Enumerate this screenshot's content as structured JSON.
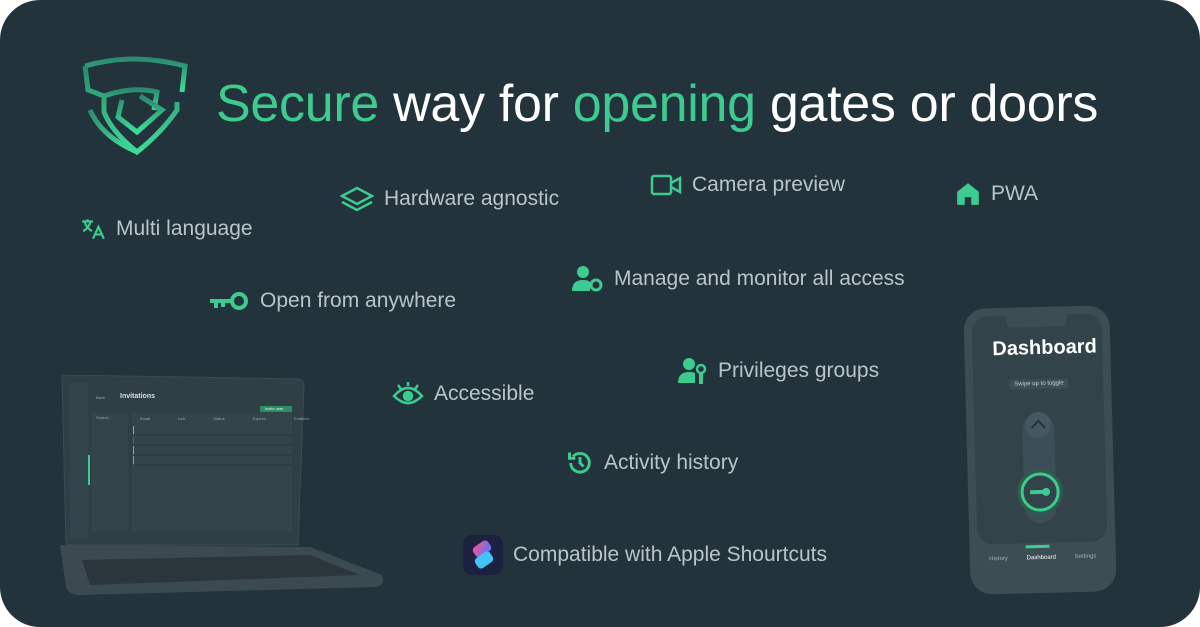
{
  "headline": {
    "w1": "Secure",
    "w2": " way for ",
    "w3": "opening",
    "w4": " gates or doors"
  },
  "features": [
    {
      "label": "Multi language",
      "icon": "translate-icon"
    },
    {
      "label": "Hardware agnostic",
      "icon": "layers-icon"
    },
    {
      "label": "Camera preview",
      "icon": "video-camera-icon"
    },
    {
      "label": "PWA",
      "icon": "home-icon"
    },
    {
      "label": "Manage and monitor all access",
      "icon": "user-gear-icon"
    },
    {
      "label": "Open from anywhere",
      "icon": "key-icon"
    },
    {
      "label": "Privileges groups",
      "icon": "user-lock-icon"
    },
    {
      "label": "Accessible",
      "icon": "eye-icon"
    },
    {
      "label": "Activity history",
      "icon": "history-icon"
    },
    {
      "label": "Compatible with Apple Shourtcuts",
      "icon": "shortcuts-app-icon"
    }
  ],
  "laptop": {
    "page_title": "Invitations",
    "back": "Back",
    "search_placeholder": "Search",
    "invite_button": "Invite user",
    "columns": [
      "Email",
      "Link",
      "Status",
      "Expires",
      "Enabled"
    ],
    "row_colors": [
      "#3ecb8f",
      "#b03a3a",
      "#c9932a",
      "#c9932a"
    ]
  },
  "phone": {
    "title": "Dashboard",
    "hint": "Swipe up to toggle",
    "nav": [
      "History",
      "Dashboard",
      "Settings"
    ],
    "active_nav": "Dashboard"
  },
  "colors": {
    "background": "#22333b",
    "accent": "#3ecb8f",
    "text": "#b9c5c9"
  }
}
